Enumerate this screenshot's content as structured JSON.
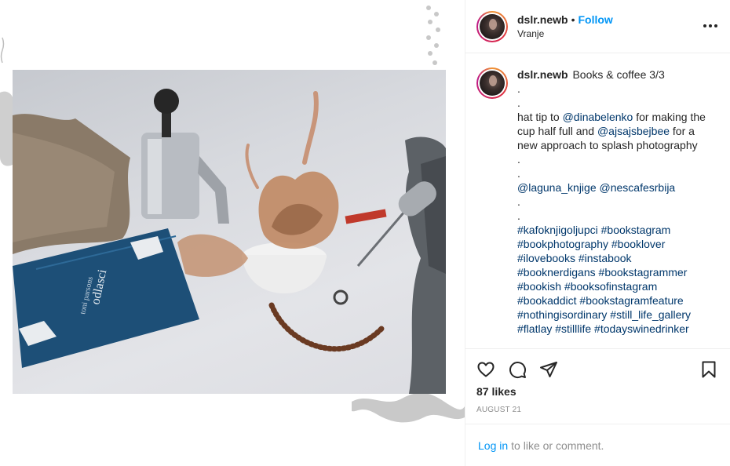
{
  "post": {
    "username": "dslr.newb",
    "separator": "•",
    "follow_label": "Follow",
    "location": "Vranje"
  },
  "caption": {
    "username": "dslr.newb",
    "title": "Books & coffee 3/3",
    "dot1": ".",
    "dot2": ".",
    "tip_prefix": "hat tip to ",
    "mention1": "@dinabelenko",
    "tip_mid": " for making the cup half full and ",
    "mention2": "@ajsajsbejbee",
    "tip_suffix": " for a new approach to splash photography",
    "dot3": ".",
    "dot4": ".",
    "mention3": "@laguna_knjige",
    "mention4": "@nescafesrbija",
    "dot5": ".",
    "dot6": ".",
    "hashtags": [
      "#kafoknjigoljupci",
      "#bookstagram",
      "#bookphotography",
      "#booklover",
      "#ilovebooks",
      "#instabook",
      "#booknerdigans",
      "#bookstagrammer",
      "#bookish",
      "#booksofinstagram",
      "#bookaddict",
      "#bookstagramfeature",
      "#nothingisordinary",
      "#still_life_gallery",
      "#flatlay",
      "#stilllife",
      "#todayswinedrinker"
    ]
  },
  "actions": {
    "icons": [
      "heart-icon",
      "comment-icon",
      "share-icon",
      "bookmark-icon"
    ],
    "likes": "87 likes",
    "date": "AUGUST 21"
  },
  "login": {
    "link": "Log in",
    "text": "to like or comment."
  },
  "photo": {
    "book_title": "odlasci",
    "book_author": "toni parsons"
  },
  "colors": {
    "accent": "#0095f6",
    "link": "#00376b",
    "text": "#262626",
    "muted": "#8e8e8e",
    "border": "#efefef"
  }
}
